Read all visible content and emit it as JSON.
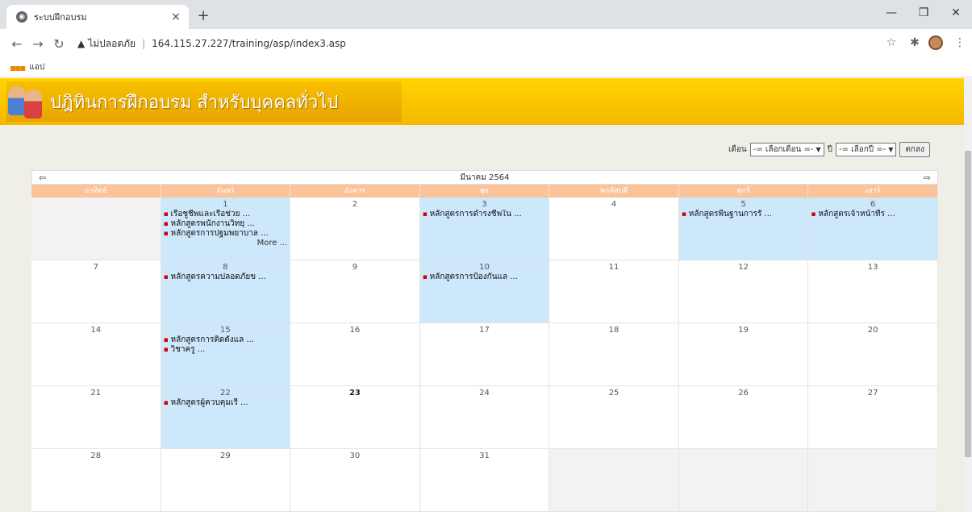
{
  "browser": {
    "tab_title": "ระบบฝึกอบรม",
    "tab_close": "×",
    "new_tab": "+",
    "insecure_label": "ไม่ปลอดภัย",
    "url": "164.115.27.227/training/asp/index3.asp",
    "bookmarks_apps": "แอป"
  },
  "page": {
    "banner_title": "ปฎิทินการฝึกอบรม สำหรับบุคคลทั่วไป",
    "filter": {
      "month_label": "เดือน",
      "month_value": "-= เลือกเดือน =-",
      "year_label": "ปี",
      "year_value": "-= เลือกปี =-",
      "submit": "ตกลง"
    }
  },
  "calendar": {
    "title": "มีนาคม 2564",
    "days_of_week": [
      "อาทิตย์",
      "จันทร์",
      "อังคาร",
      "พุธ",
      "พฤหัสบดี",
      "ศุกร์",
      "เสาร์"
    ],
    "weeks": [
      [
        {
          "day": "",
          "events": [],
          "empty": true
        },
        {
          "day": "1",
          "events": [
            "เรือชูชีพและเรือช่วย ...",
            "หลักสูตรพนักงานวิทยุ ...",
            "หลักสูตรการปฐมพยาบาล ..."
          ],
          "more": "More ..."
        },
        {
          "day": "2",
          "events": []
        },
        {
          "day": "3",
          "events": [
            "หลักสูตรการดำรงชีพใน ..."
          ]
        },
        {
          "day": "4",
          "events": []
        },
        {
          "day": "5",
          "events": [
            "หลักสูตรพื้นฐานการรั ..."
          ]
        },
        {
          "day": "6",
          "events": [
            "หลักสูตรเจ้าหน้าที่ร ..."
          ]
        }
      ],
      [
        {
          "day": "7",
          "events": []
        },
        {
          "day": "8",
          "events": [
            "หลักสูตรความปลอดภัยข ..."
          ]
        },
        {
          "day": "9",
          "events": []
        },
        {
          "day": "10",
          "events": [
            "หลักสูตรการป้องกันแล ..."
          ]
        },
        {
          "day": "11",
          "events": []
        },
        {
          "day": "12",
          "events": []
        },
        {
          "day": "13",
          "events": []
        }
      ],
      [
        {
          "day": "14",
          "events": []
        },
        {
          "day": "15",
          "events": [
            "หลักสูตรการติดตั้งแล ...",
            "วิชาครู ..."
          ]
        },
        {
          "day": "16",
          "events": []
        },
        {
          "day": "17",
          "events": []
        },
        {
          "day": "18",
          "events": []
        },
        {
          "day": "19",
          "events": []
        },
        {
          "day": "20",
          "events": []
        }
      ],
      [
        {
          "day": "21",
          "events": []
        },
        {
          "day": "22",
          "events": [
            "หลักสูตรผู้ควบคุมเรื ..."
          ]
        },
        {
          "day": "23",
          "events": [],
          "today": true
        },
        {
          "day": "24",
          "events": []
        },
        {
          "day": "25",
          "events": []
        },
        {
          "day": "26",
          "events": []
        },
        {
          "day": "27",
          "events": []
        }
      ],
      [
        {
          "day": "28",
          "events": []
        },
        {
          "day": "29",
          "events": []
        },
        {
          "day": "30",
          "events": []
        },
        {
          "day": "31",
          "events": []
        },
        {
          "day": "",
          "events": [],
          "empty": true
        },
        {
          "day": "",
          "events": [],
          "empty": true
        },
        {
          "day": "",
          "events": [],
          "empty": true
        }
      ]
    ]
  }
}
